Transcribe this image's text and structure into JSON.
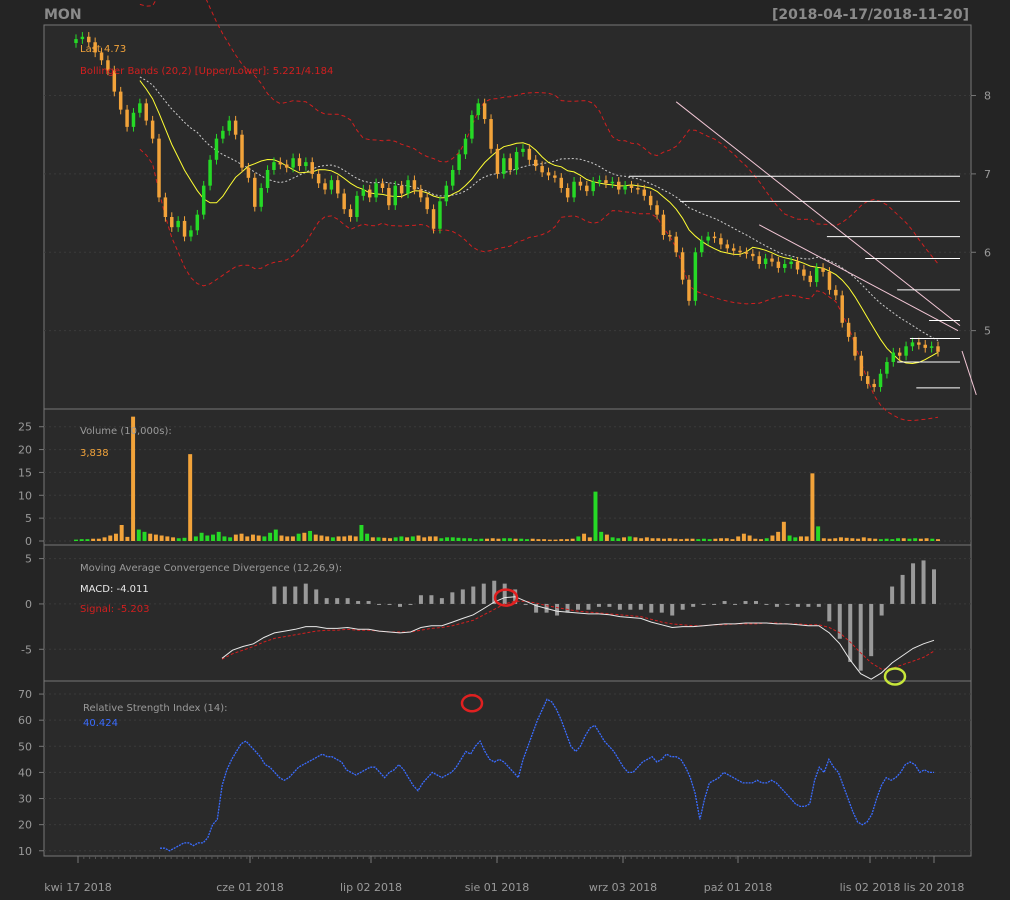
{
  "header": {
    "symbol": "MON",
    "range": "[2018-04-17/2018-11-20]"
  },
  "colors": {
    "bg": "#242424",
    "panel": "#2a2a2a",
    "frame": "#777777",
    "grid": "#3a3a3a",
    "up": "#26d926",
    "down": "#f2a33a",
    "text": "#9a9a9a",
    "sma": "#ffff33",
    "bb": "#d21f1f",
    "bbmid": "#cccccc",
    "macd": "#e8e8e8",
    "signal": "#d21f1f",
    "hist": "#9a9a9a",
    "rsi": "#3a6cff",
    "trend": "#f3c7d6",
    "level": "#ffffff",
    "marker_red": "#e02020",
    "marker_green": "#c7e63a"
  },
  "legends": {
    "last": "Last 4.73",
    "bbands": "Bollinger Bands (20,2) [Upper/Lower]: 5.221/4.184",
    "volume_title": "Volume (10,000s):",
    "volume_value": "3,838",
    "macd_title": "Moving Average Convergence Divergence (12,26,9):",
    "macd_value": "MACD: -4.011",
    "signal_value": "Signal: -5.203",
    "rsi_title": "Relative Strength Index (14):",
    "rsi_value": "40.424"
  },
  "chart_data": [
    {
      "type": "candlestick",
      "title": "MON",
      "ylim": [
        4,
        8.9
      ],
      "y_ticks": [
        "5",
        "6",
        "7",
        "8"
      ],
      "x_ticks": [
        "kwi 17 2018",
        "cze 01 2018",
        "lip 02 2018",
        "sie 01 2018",
        "wrz 03 2018",
        "paź 01 2018",
        "lis 02 2018",
        "lis 20 2018"
      ],
      "last": 4.73,
      "bbands": {
        "upper": 5.221,
        "lower": 4.184
      },
      "closes": [
        8.72,
        8.75,
        8.68,
        8.55,
        8.45,
        8.32,
        8.05,
        7.82,
        7.6,
        7.78,
        7.9,
        7.68,
        7.45,
        6.7,
        6.45,
        6.32,
        6.4,
        6.2,
        6.28,
        6.48,
        6.85,
        7.18,
        7.45,
        7.55,
        7.68,
        7.5,
        7.08,
        6.95,
        6.58,
        6.82,
        7.05,
        7.15,
        7.12,
        7.08,
        7.2,
        7.1,
        7.15,
        7.0,
        6.88,
        6.8,
        6.92,
        6.75,
        6.55,
        6.45,
        6.72,
        6.8,
        6.7,
        6.88,
        6.82,
        6.6,
        6.85,
        6.75,
        6.92,
        6.8,
        6.7,
        6.55,
        6.3,
        6.65,
        6.85,
        7.05,
        7.25,
        7.45,
        7.75,
        7.9,
        7.7,
        7.32,
        7.0,
        7.2,
        7.05,
        7.28,
        7.32,
        7.18,
        7.1,
        7.02,
        6.98,
        6.95,
        6.82,
        6.7,
        6.9,
        6.85,
        6.78,
        6.9,
        6.92,
        6.88,
        6.9,
        6.8,
        6.85,
        6.82,
        6.8,
        6.72,
        6.6,
        6.48,
        6.22,
        6.2,
        6.0,
        5.65,
        5.38,
        6.0,
        6.15,
        6.2,
        6.18,
        6.1,
        6.05,
        6.02,
        6.0,
        5.98,
        5.95,
        5.85,
        5.92,
        5.88,
        5.8,
        5.85,
        5.88,
        5.78,
        5.7,
        5.62,
        5.8,
        5.75,
        5.52,
        5.45,
        5.1,
        4.92,
        4.68,
        4.42,
        4.32,
        4.28,
        4.45,
        4.6,
        4.72,
        4.68,
        4.8,
        4.85,
        4.82,
        4.78,
        4.8,
        4.73
      ],
      "volumes": [
        0.3,
        0.4,
        0.4,
        0.5,
        0.5,
        0.8,
        1.2,
        1.6,
        3.5,
        0.9,
        27.2,
        2.5,
        2.0,
        1.6,
        1.4,
        1.2,
        1.0,
        0.8,
        0.6,
        0.7,
        19.0,
        1.0,
        1.8,
        1.2,
        1.4,
        2.0,
        1.0,
        0.8,
        1.4,
        1.6,
        1.0,
        1.4,
        1.2,
        1.0,
        1.8,
        2.5,
        1.2,
        1.0,
        1.0,
        1.6,
        1.8,
        2.2,
        1.4,
        1.2,
        1.0,
        0.8,
        1.0,
        1.0,
        1.2,
        1.0,
        3.5,
        1.6,
        0.8,
        0.8,
        0.7,
        0.6,
        0.8,
        1.0,
        0.8,
        1.0,
        1.2,
        0.8,
        1.0,
        1.0,
        0.6,
        0.8,
        0.8,
        0.7,
        0.6,
        0.6,
        0.4,
        0.5,
        0.5,
        0.6,
        0.5,
        0.6,
        0.6,
        0.5,
        0.5,
        0.4,
        0.5,
        0.4,
        0.4,
        0.3,
        0.3,
        0.4,
        0.4,
        0.5,
        1.0,
        1.6,
        0.8,
        10.8,
        2.0,
        1.4,
        0.8,
        0.6,
        0.8,
        1.0,
        0.8,
        0.6,
        0.8,
        0.6,
        0.6,
        0.5,
        0.6,
        0.5,
        0.4,
        0.5,
        0.5,
        0.4,
        0.5,
        0.4,
        0.5,
        0.6,
        0.6,
        0.4,
        1.0,
        1.6,
        1.2,
        0.5,
        0.4,
        0.6,
        1.2,
        2.0,
        4.2,
        1.2,
        0.8,
        1.0,
        1.0,
        14.8,
        3.2,
        0.6,
        0.5,
        0.6,
        0.8,
        0.7,
        0.6,
        0.5,
        0.8,
        0.6,
        0.5,
        0.4,
        0.5,
        0.4,
        0.6,
        0.6,
        0.5,
        0.6,
        0.5,
        0.6,
        0.5,
        0.4
      ],
      "volume_ylim": [
        0,
        28
      ],
      "volume_ticks": [
        "0",
        "5",
        "10",
        "15",
        "20",
        "25"
      ],
      "macd": [
        -6.0,
        -5.1,
        -4.7,
        -4.4,
        -3.7,
        -3.2,
        -3.0,
        -2.8,
        -2.5,
        -2.5,
        -2.7,
        -2.7,
        -2.6,
        -2.8,
        -2.8,
        -3.0,
        -3.1,
        -3.2,
        -3.1,
        -2.6,
        -2.4,
        -2.4,
        -2.0,
        -1.6,
        -1.2,
        -0.5,
        0.2,
        0.7,
        0.8,
        0.3,
        -0.2,
        -0.5,
        -0.8,
        -0.9,
        -1.0,
        -1.1,
        -1.1,
        -1.2,
        -1.4,
        -1.5,
        -1.6,
        -2.0,
        -2.3,
        -2.6,
        -2.5,
        -2.5,
        -2.4,
        -2.3,
        -2.2,
        -2.2,
        -2.1,
        -2.1,
        -2.1,
        -2.2,
        -2.2,
        -2.3,
        -2.4,
        -2.4,
        -3.2,
        -4.4,
        -6.2,
        -7.7,
        -8.3,
        -7.6,
        -6.5,
        -5.7,
        -4.9,
        -4.4,
        -4.011
      ],
      "macd_signal": [
        -6.1,
        -5.5,
        -5.1,
        -4.7,
        -4.2,
        -3.8,
        -3.6,
        -3.4,
        -3.2,
        -3.0,
        -2.9,
        -2.9,
        -2.8,
        -2.9,
        -2.9,
        -3.0,
        -3.1,
        -3.1,
        -3.1,
        -2.9,
        -2.7,
        -2.6,
        -2.4,
        -2.1,
        -1.8,
        -1.2,
        -0.6,
        0.0,
        0.3,
        0.3,
        0.1,
        -0.2,
        -0.4,
        -0.6,
        -0.8,
        -0.9,
        -1.0,
        -1.1,
        -1.2,
        -1.3,
        -1.4,
        -1.7,
        -2.0,
        -2.2,
        -2.3,
        -2.4,
        -2.4,
        -2.3,
        -2.3,
        -2.2,
        -2.2,
        -2.2,
        -2.1,
        -2.1,
        -2.2,
        -2.2,
        -2.3,
        -2.3,
        -2.6,
        -3.2,
        -4.2,
        -5.4,
        -6.5,
        -7.2,
        -7.1,
        -6.7,
        -6.3,
        -5.9,
        -5.203
      ],
      "macd_ylim": [
        -8.5,
        6.5
      ],
      "macd_ticks": [
        "-5",
        "0",
        "5"
      ],
      "rsi": [
        11,
        11,
        10,
        11,
        12,
        13,
        13,
        12,
        13,
        13,
        15,
        20,
        22,
        35,
        41,
        45,
        48,
        51,
        52,
        50,
        48,
        46,
        43,
        42,
        40,
        38,
        37,
        38,
        40,
        42,
        43,
        44,
        45,
        46,
        47,
        46,
        46,
        45,
        44,
        41,
        40,
        39,
        40,
        41,
        42,
        42,
        40,
        38,
        40,
        41,
        43,
        41,
        38,
        35,
        33,
        36,
        38,
        40,
        39,
        38,
        39,
        40,
        42,
        45,
        48,
        47,
        50,
        52,
        48,
        45,
        44,
        45,
        44,
        42,
        40,
        38,
        45,
        50,
        55,
        60,
        64,
        68,
        67,
        64,
        60,
        55,
        50,
        48,
        50,
        54,
        57,
        58,
        55,
        52,
        50,
        48,
        45,
        42,
        40,
        40,
        42,
        44,
        45,
        46,
        44,
        45,
        47,
        46,
        46,
        45,
        42,
        38,
        32,
        22,
        30,
        36,
        37,
        38,
        40,
        39,
        38,
        37,
        36,
        36,
        36,
        37,
        36,
        36,
        37,
        36,
        34,
        32,
        30,
        28,
        27,
        27,
        28,
        37,
        42,
        40,
        45,
        42,
        40,
        35,
        30,
        25,
        21,
        20,
        21,
        24,
        30,
        35,
        38,
        37,
        38,
        40,
        43,
        44,
        43,
        40,
        41,
        40,
        40
      ],
      "rsi_ylim": [
        8,
        75
      ],
      "rsi_ticks": [
        "10",
        "20",
        "30",
        "40",
        "50",
        "60",
        "70"
      ]
    }
  ]
}
